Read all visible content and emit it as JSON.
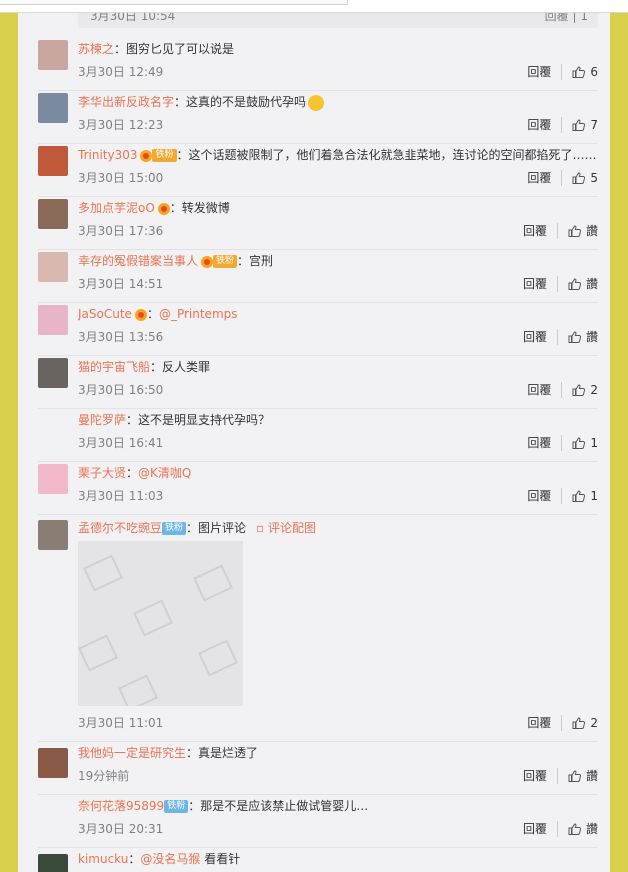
{
  "prev_row": {
    "time": "3月30日 10:54",
    "reply": "回覆",
    "likes": "1"
  },
  "comments": [
    {
      "avatar_color": "#c9a6a0",
      "user": "苏楝之",
      "text": "：图穷匕见了可以说是",
      "time": "3月30日 12:49",
      "reply": "回覆",
      "likes": "6"
    },
    {
      "avatar_color": "#7a8aa0",
      "user": "李华出新反政名字",
      "text": "：这真的不是鼓励代孕吗",
      "time": "3月30日 12:23",
      "reply": "回覆",
      "likes": "7"
    },
    {
      "avatar_color": "#c05a3a",
      "user": "Trinity303",
      "badge": "铁粉",
      "text": "：这个话题被限制了，他们着急合法化就急韭菜地，连讨论的空间都掐死了……",
      "time": "3月30日 15:00",
      "reply": "回覆",
      "likes": "5"
    },
    {
      "avatar_color": "#8a6a58",
      "user": "多加点芋泥oO",
      "text": "：转发微博",
      "time": "3月30日 17:36",
      "reply": "回覆",
      "likes": "讚"
    },
    {
      "avatar_color": "#d9b8b0",
      "user": "幸存的冤假错案当事人",
      "badge": "铁粉",
      "text": "：宫刑",
      "time": "3月30日 14:51",
      "reply": "回覆",
      "likes": "讚"
    },
    {
      "avatar_color": "#e8b4c8",
      "user": "JaSoCute",
      "badge": "",
      "text": "：",
      "mention": "@_Printemps",
      "time": "3月30日 13:56",
      "reply": "回覆",
      "likes": "讚"
    },
    {
      "avatar_color": "#6a6460",
      "user": "猫的宇宙飞船",
      "text": "：反人类罪",
      "time": "3月30日 16:50",
      "reply": "回覆",
      "likes": "2"
    },
    {
      "avatar_color": "",
      "user": "曼陀罗萨",
      "text": "：这不是明显支持代孕吗？",
      "time": "3月30日 16:41",
      "reply": "回覆",
      "likes": "1"
    },
    {
      "avatar_color": "#f0b8c8",
      "user": "栗子大贤",
      "text": "：",
      "mention": "@K清咖Q",
      "time": "3月30日 11:03",
      "reply": "回覆",
      "likes": "1"
    },
    {
      "avatar_color": "#8a7e74",
      "user": "孟德尔不吃豌豆",
      "badge": "铁粉",
      "text": "：图片评论",
      "pic_link": "评论配图",
      "time": "3月30日 11:01",
      "reply": "回覆",
      "likes": "2"
    },
    {
      "avatar_color": "#8a5a48",
      "user": "我他妈一定是研究生",
      "text": "：真是烂透了",
      "time": "19分钟前",
      "reply": "回覆",
      "likes": "讚"
    },
    {
      "avatar_color": "",
      "user": "奈何花落95899",
      "badge": "铁粉",
      "text": "：那是不是应该禁止做试管婴儿…",
      "time": "3月30日 20:31",
      "reply": "回覆",
      "likes": "讚"
    },
    {
      "avatar_color": "#3a4a3a",
      "user": "kimucku",
      "text": "：",
      "mention": "@没名马猴",
      "text2": " 看看针",
      "time": "",
      "reply": "",
      "likes": ""
    }
  ]
}
